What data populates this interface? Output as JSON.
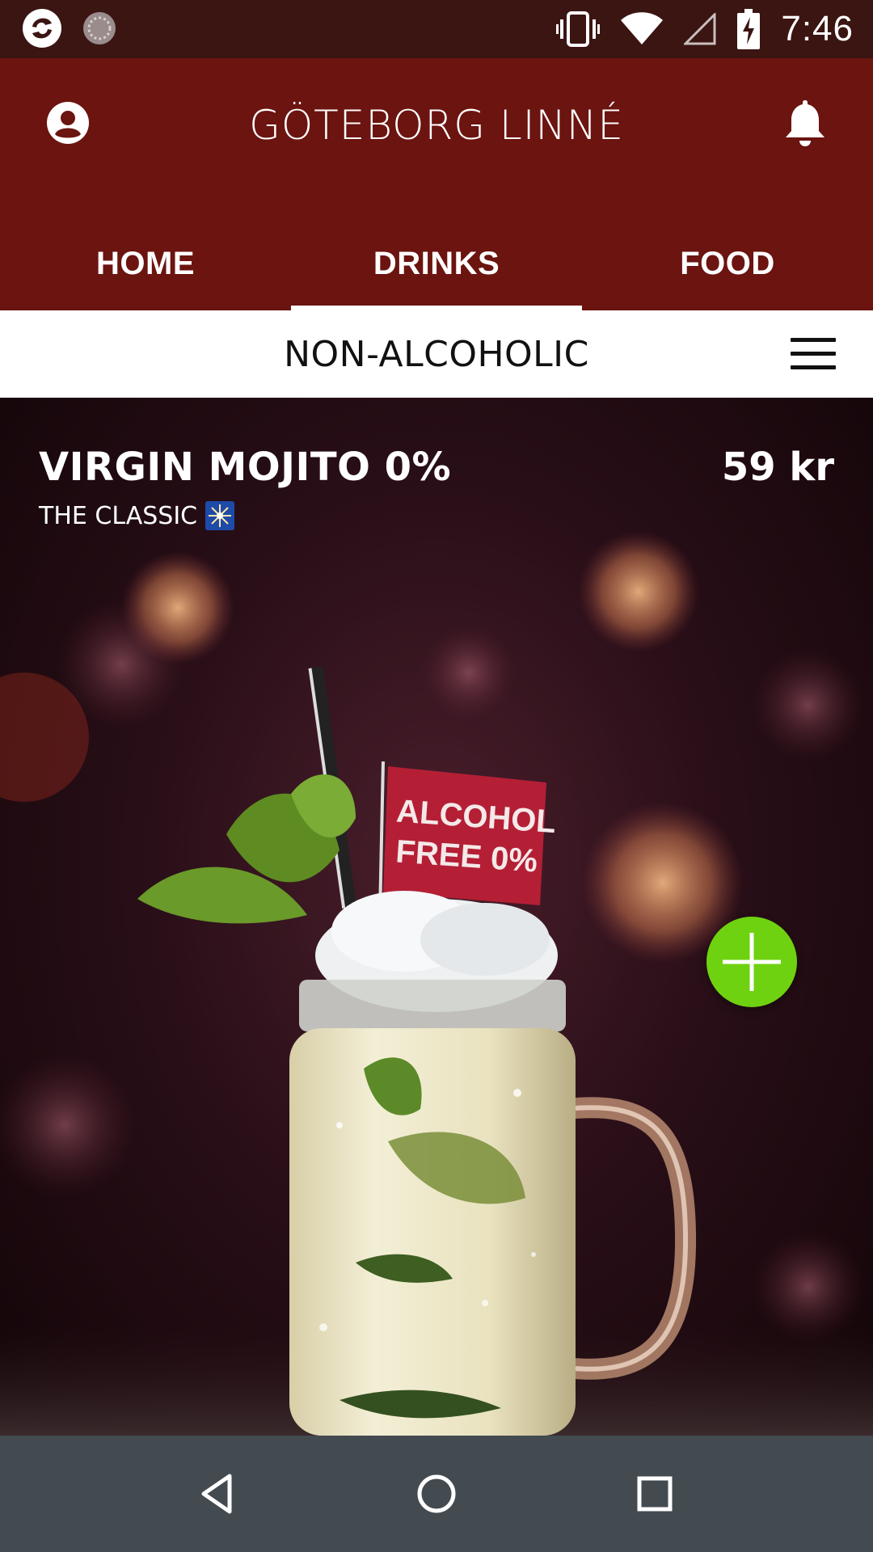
{
  "status_bar": {
    "time": "7:46",
    "icons": [
      "app-logo-icon",
      "sync-icon",
      "vibrate-icon",
      "wifi-icon",
      "signal-icon",
      "battery-charging-icon"
    ]
  },
  "app_bar": {
    "title": "GÖTEBORG LINNÉ",
    "profile_icon": "account-circle-icon",
    "notification_icon": "bell-icon"
  },
  "tabs": [
    {
      "label": "HOME",
      "active": false
    },
    {
      "label": "DRINKS",
      "active": true
    },
    {
      "label": "FOOD",
      "active": false
    }
  ],
  "category_bar": {
    "title": "NON-ALCOHOLIC",
    "menu_icon": "hamburger-menu-icon"
  },
  "product": {
    "name": "VIRGIN MOJITO 0%",
    "subtitle": "THE CLASSIC",
    "subtitle_icon": "sparkle-icon",
    "price": "59 kr",
    "image_flag_text_line1": "ALCOHOL",
    "image_flag_text_line2": "FREE 0%",
    "add_icon": "plus-icon"
  },
  "nav_bar": {
    "buttons": [
      "back-icon",
      "home-icon",
      "recents-icon"
    ]
  },
  "colors": {
    "status_bar": "#3b1512",
    "app_bar": "#6b1410",
    "accent_add": "#6ed210",
    "nav_bar": "#434a50"
  }
}
